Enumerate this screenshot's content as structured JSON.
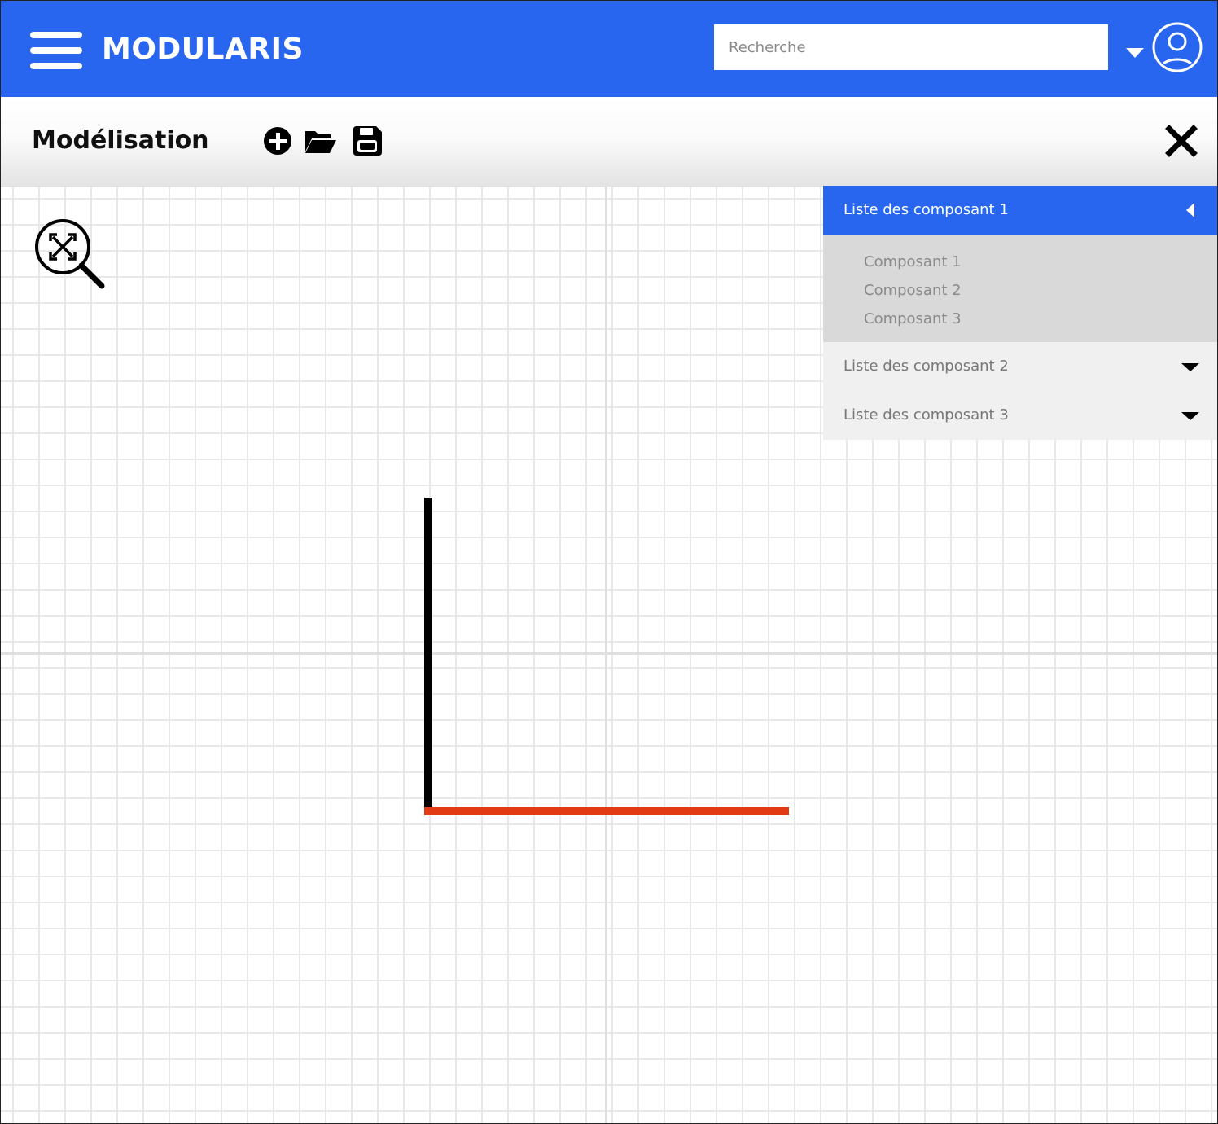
{
  "app": {
    "brand": "MODULARIS"
  },
  "header": {
    "search_placeholder": "Recherche"
  },
  "toolbar": {
    "title": "Modélisation",
    "tools": [
      "plus-circle-icon",
      "folder-open-icon",
      "floppy-disk-icon"
    ]
  },
  "colors": {
    "primary": "#2866ef",
    "wall_black": "#000000",
    "wall_red": "#e23a12",
    "panel_expanded_bg": "#d9d9d9",
    "panel_collapsed_bg": "#f0f0f0"
  },
  "panel": {
    "groups": [
      {
        "label": "Liste des composant 1",
        "expanded": true,
        "items": [
          "Composant 1",
          "Composant 2",
          "Composant 3"
        ]
      },
      {
        "label": "Liste des composant 2",
        "expanded": false
      },
      {
        "label": "Liste des composant 3",
        "expanded": false
      }
    ]
  }
}
